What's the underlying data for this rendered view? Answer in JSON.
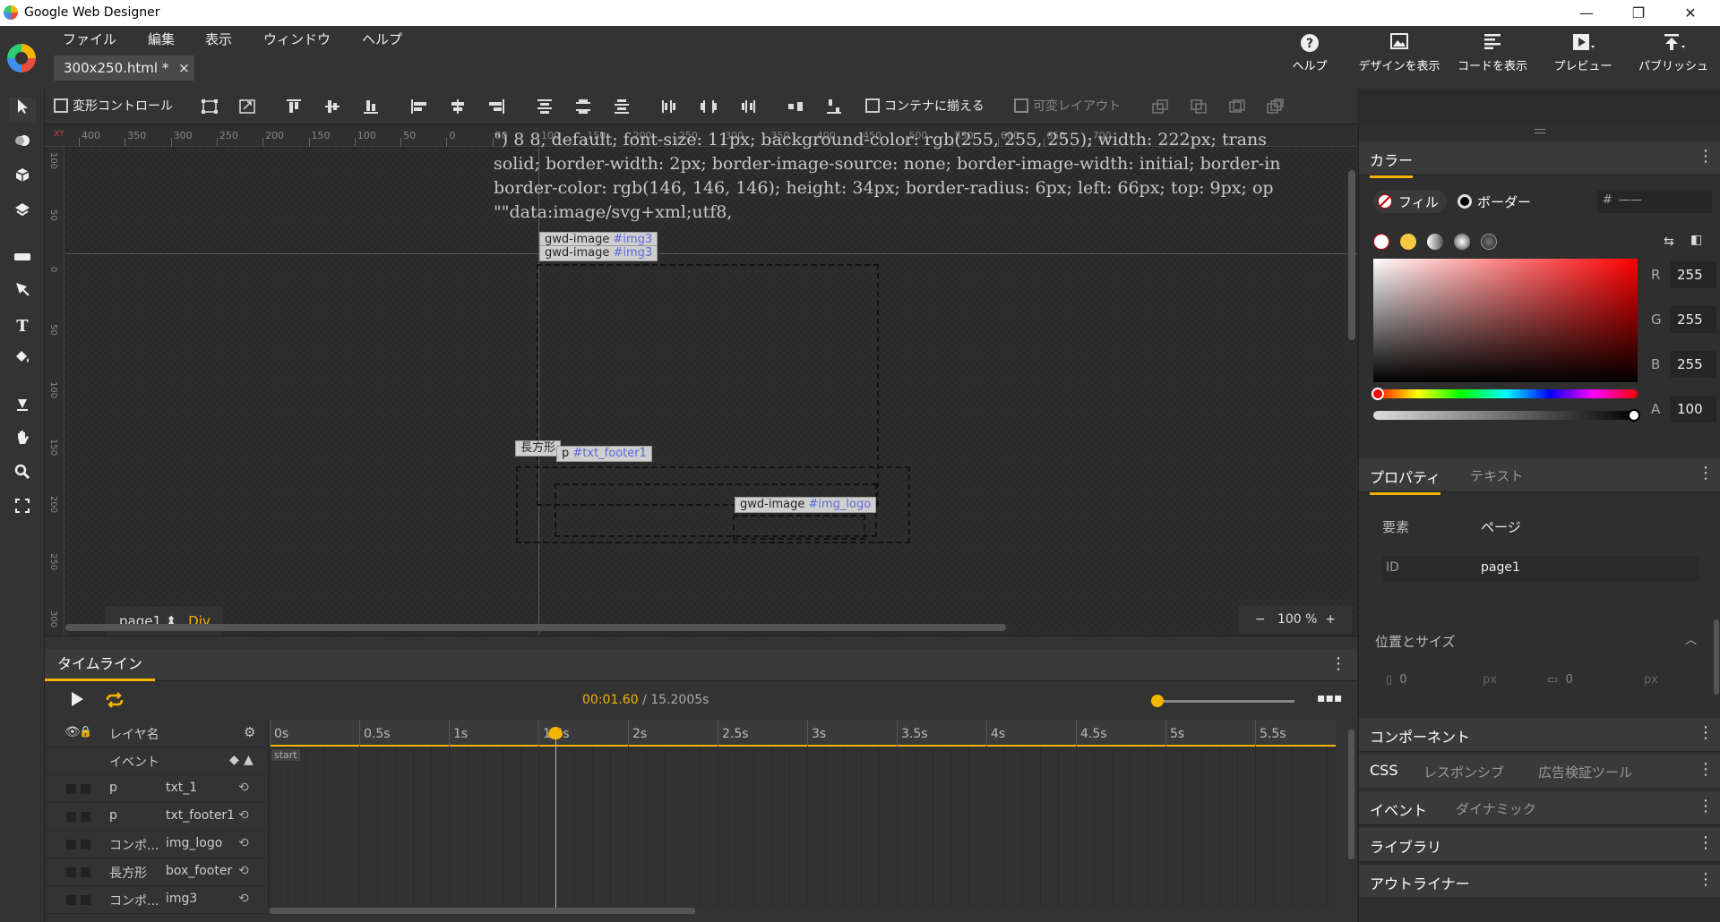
{
  "window": {
    "title": "Google Web Designer",
    "minimize": "—",
    "maximize": "❐",
    "close": "✕"
  },
  "menu": [
    "ファイル",
    "編集",
    "表示",
    "ウィンドウ",
    "ヘルプ"
  ],
  "file_tab": {
    "label": "300x250.html *",
    "close": "×"
  },
  "top_actions": {
    "help": "ヘルプ",
    "design_view": "デザインを表示",
    "code_view": "コードを表示",
    "preview": "プレビュー",
    "publish": "パブリッシュ"
  },
  "toolbar": {
    "transform_control": "変形コントロール",
    "fit_container": "コンテナに揃える",
    "responsive_layout": "可変レイアウト"
  },
  "ruler": {
    "corner": "XY",
    "top_labels": [
      "400",
      "350",
      "300",
      "250",
      "200",
      "150",
      "100",
      "50",
      "0",
      "50",
      "100",
      "150",
      "200",
      "250",
      "300",
      "350",
      "400",
      "450",
      "500",
      "550",
      "600",
      "650",
      "700"
    ],
    "left_labels": [
      "100",
      "50",
      "0",
      "50",
      "100",
      "150",
      "200",
      "250",
      "300"
    ]
  },
  "stage": {
    "labels": {
      "img3_a": {
        "type": "gwd-image",
        "id": "#img3"
      },
      "img3_b": {
        "type": "gwd-image",
        "id": "#img3"
      },
      "rect": {
        "type": "長方形"
      },
      "txt_footer": {
        "type": "p",
        "id": "#txt_footer1"
      },
      "img_logo": {
        "type": "gwd-image",
        "id": "#img_logo"
      }
    },
    "overflow_text": [
      "\") 8 8, default; font-size: 11px; background-color: rgb(255, 255, 255); width: 222px; trans",
      "solid; border-width: 2px; border-image-source: none; border-image-width: initial; border-in",
      "border-color: rgb(146, 146, 146); height: 34px; border-radius: 6px; left: 66px; top: 9px; op",
      "\"\"data:image/svg+xml;utf8,"
    ],
    "breadcrumb": {
      "page": "page1",
      "arrow": "⬍",
      "element": "Div"
    },
    "zoom": {
      "minus": "−",
      "value": "100 %",
      "plus": "+"
    }
  },
  "timeline": {
    "tab": "タイムライン",
    "current_time": "00:01.60",
    "total_time": "/ 15.2005s",
    "header": {
      "layer_name": "レイヤ名",
      "event": "イベント",
      "start": "start"
    },
    "ruler_labels": [
      "0s",
      "0.5s",
      "1s",
      "1.5s",
      "2s",
      "2.5s",
      "3s",
      "3.5s",
      "4s",
      "4.5s",
      "5s",
      "5.5s"
    ],
    "layers": [
      {
        "type": "p",
        "name": "txt_1"
      },
      {
        "type": "p",
        "name": "txt_footer1"
      },
      {
        "type": "コンポ...",
        "name": "img_logo"
      },
      {
        "type": "長方形",
        "name": "box_footer"
      },
      {
        "type": "コンポ...",
        "name": "img3"
      }
    ],
    "playhead_fraction": 0.29
  },
  "right_panel": {
    "color": {
      "title": "カラー",
      "fill": "フィル",
      "border": "ボーダー",
      "hex_prefix": "#",
      "hex_value": "——",
      "r_label": "R",
      "r": "255",
      "g_label": "G",
      "g": "255",
      "b_label": "B",
      "b": "255",
      "a_label": "A",
      "a": "100"
    },
    "properties": {
      "tab_properties": "プロパティ",
      "tab_text": "テキスト",
      "element_label": "要素",
      "element_value": "ページ",
      "id_label": "ID",
      "id_value": "page1",
      "position_size": "位置とサイズ",
      "x_value": "0",
      "y_value": "0",
      "unit": "px"
    },
    "sections": {
      "components": "コンポーネント",
      "css": "CSS",
      "responsive": "レスポンシブ",
      "ad_validator": "広告検証ツール",
      "events": "イベント",
      "dynamic": "ダイナミック",
      "library": "ライブラリ",
      "outliner": "アウトライナー"
    }
  },
  "colors": {
    "accent": "#f5b400",
    "id_link": "#5b6ad8"
  }
}
